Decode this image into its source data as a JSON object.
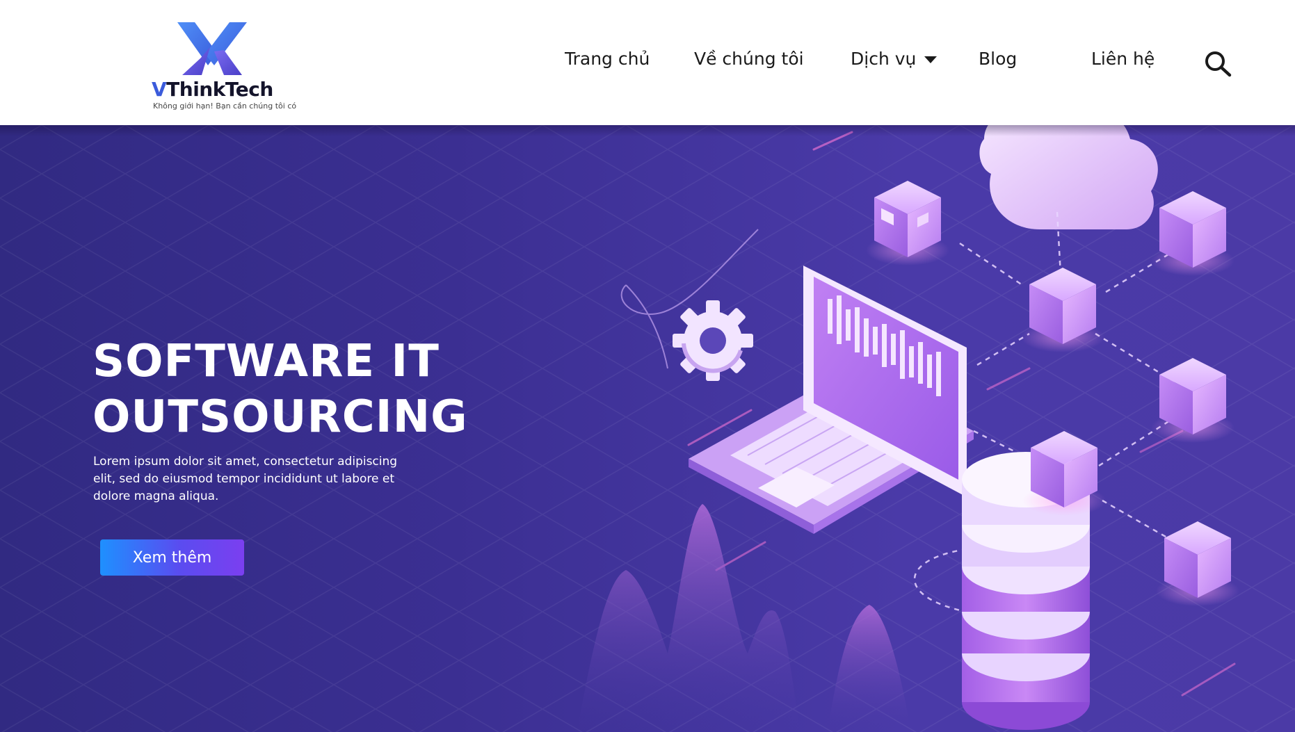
{
  "brand": {
    "name_prefix": "V",
    "name_rest": "ThinkTech",
    "tagline": "Không giới hạn! Bạn cần chúng tôi có",
    "logo_icon": "vx-logo-mark",
    "colors": {
      "primary": "#3b5bdb",
      "accent": "#4f8ff7",
      "dark": "#14142b"
    }
  },
  "nav": {
    "items": [
      {
        "label": "Trang chủ"
      },
      {
        "label": "Về chúng tôi"
      },
      {
        "label": "Dịch vụ",
        "has_dropdown": true
      },
      {
        "label": "Blog"
      },
      {
        "label": "Liên hệ"
      }
    ],
    "search_icon": "search-icon"
  },
  "hero": {
    "title_line1": "SOFTWARE IT",
    "title_line2": "OUTSOURCING",
    "description": "Lorem ipsum dolor sit amet, consectetur adipiscing elit, sed do eiusmod tempor incididunt ut labore et dolore magna aliqua.",
    "cta_label": "Xem thêm",
    "background_colors": [
      "#312a82",
      "#4b3aa6"
    ],
    "illustration": "isometric-network-illustration"
  }
}
